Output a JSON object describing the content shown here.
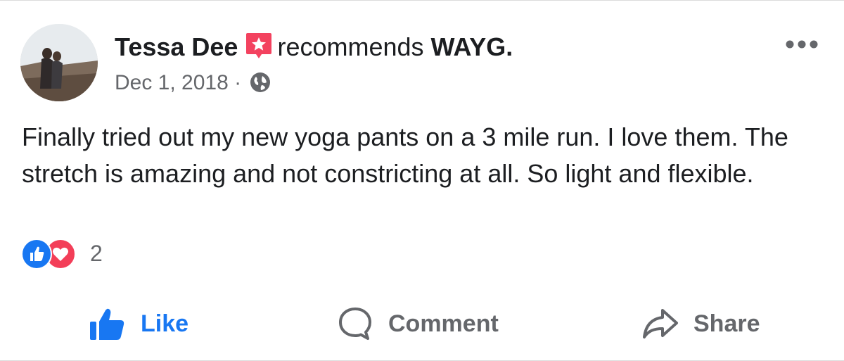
{
  "post": {
    "author": "Tessa Dee",
    "action_text": "recommends",
    "page_name": "WAYG.",
    "date": "Dec 1, 2018",
    "separator": "·",
    "privacy_icon": "globe-icon",
    "body": "Finally tried out my new yoga pants on a 3 mile run.  I love them.  The stretch is amazing and not constricting at all. So light and flexible.",
    "reaction_count": "2"
  },
  "actions": {
    "like_label": "Like",
    "comment_label": "Comment",
    "share_label": "Share"
  },
  "colors": {
    "accent": "#1877f2",
    "love": "#f33e58",
    "recommend": "#f3425f",
    "muted": "#65676b",
    "text": "#1c1e21"
  }
}
